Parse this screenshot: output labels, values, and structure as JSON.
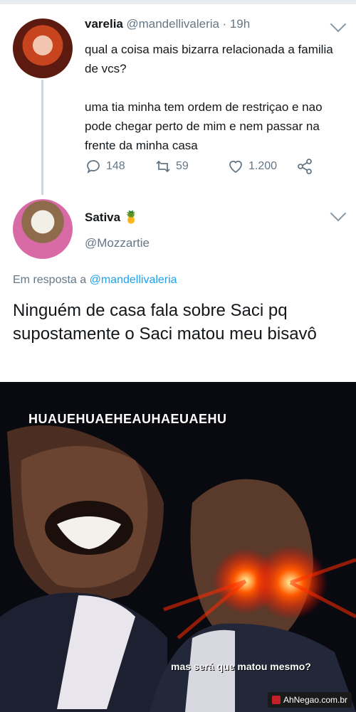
{
  "tweet1": {
    "name": "varelia",
    "handle": "@mandellivaleria",
    "time": "· 19h",
    "text": "qual a coisa mais bizarra relacionada a familia de vcs?\n\numa tia minha tem ordem de restriçao e nao pode chegar perto de mim e nem passar na frente da minha casa",
    "replies": "148",
    "retweets": "59",
    "likes": "1.200"
  },
  "tweet2": {
    "name": "Sativa",
    "emoji": "🍍",
    "handle": "@Mozzartie",
    "reply_prefix": "Em resposta a",
    "reply_to": "@mandellivaleria",
    "text": "Ninguém de casa fala sobre Saci pq supostamente o Saci matou meu bisavô"
  },
  "meme": {
    "top_text": "HUAUEHUAEHEAUHAEUAEHU",
    "bottom_text": "mas será que matou mesmo?",
    "watermark": "AhNegao.com.br"
  },
  "icons": [
    "reply-icon",
    "retweet-icon",
    "like-icon",
    "share-icon",
    "chevron-down-icon"
  ],
  "colors": {
    "muted": "#657786",
    "link": "#1da1f2",
    "text": "#14171a",
    "glow": "#ff2a00"
  }
}
